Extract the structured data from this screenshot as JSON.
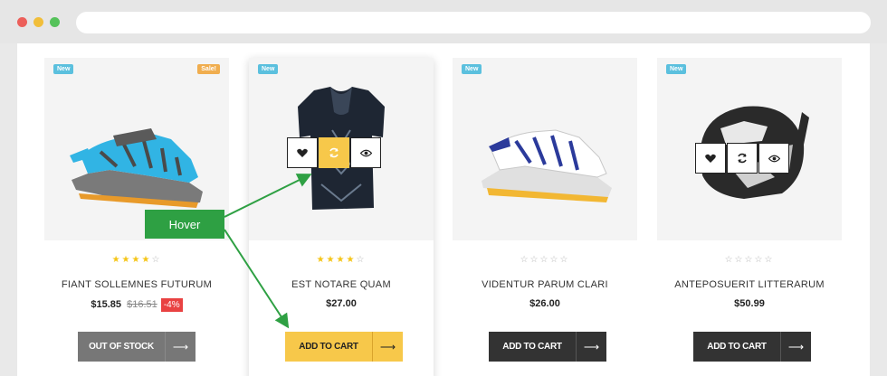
{
  "window": {
    "controls": [
      "close",
      "minimize",
      "maximize"
    ]
  },
  "annotation": {
    "hover_label": "Hover"
  },
  "products": [
    {
      "badges": [
        "New",
        "Sale!"
      ],
      "rating": 4,
      "name": "FIANT SOLLEMNES FUTURUM",
      "price": "$15.85",
      "old_price": "$16.51",
      "discount": "-4%",
      "button_label": "OUT OF STOCK",
      "button_state": "out-of-stock",
      "image_icon": "running-shoe-blue",
      "actions": []
    },
    {
      "badges": [
        "New"
      ],
      "rating": 4,
      "name": "EST NOTARE QUAM",
      "price": "$27.00",
      "button_label": "ADD TO CART",
      "button_state": "hover",
      "image_icon": "black-panther-tshirt",
      "actions": [
        "heart-icon",
        "refresh-icon",
        "eye-icon"
      ]
    },
    {
      "badges": [
        "New"
      ],
      "rating": 0,
      "name": "VIDENTUR PARUM CLARI",
      "price": "$26.00",
      "button_label": "ADD TO CART",
      "button_state": "default",
      "image_icon": "running-shoe-white",
      "actions": []
    },
    {
      "badges": [
        "New"
      ],
      "rating": 0,
      "name": "ANTEPOSUERIT LITTERARUM",
      "price": "$50.99",
      "button_label": "ADD TO CART",
      "button_state": "default",
      "image_icon": "motocross-helmet",
      "actions": [
        "heart-icon",
        "refresh-icon",
        "eye-icon"
      ]
    }
  ],
  "colors": {
    "badge_new": "#5bc0de",
    "badge_sale": "#f0ad4e",
    "accent_yellow": "#f7c84a",
    "button_dark": "#333333",
    "button_gray": "#777777",
    "discount_red": "#e94242",
    "annotation_green": "#2ea043"
  }
}
